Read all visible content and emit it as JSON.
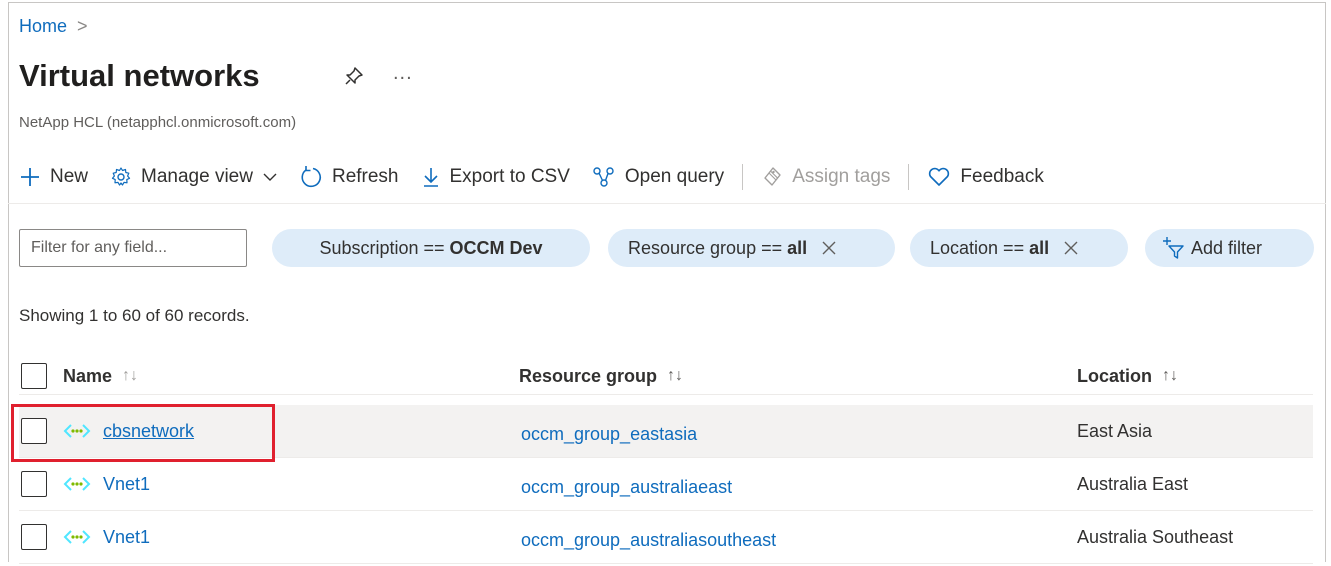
{
  "breadcrumb": {
    "home": "Home",
    "separator": ">"
  },
  "page": {
    "title": "Virtual networks",
    "more": "...",
    "subtitle": "NetApp HCL (netapphcl.onmicrosoft.com)"
  },
  "toolbar": {
    "new": "New",
    "manage_view": "Manage view",
    "refresh": "Refresh",
    "export_csv": "Export to CSV",
    "open_query": "Open query",
    "assign_tags": "Assign tags",
    "feedback": "Feedback"
  },
  "filters": {
    "search_placeholder": "Filter for any field...",
    "subscription": {
      "label": "Subscription ==",
      "value": "OCCM Dev"
    },
    "resource_group": {
      "label": "Resource group ==",
      "value": "all"
    },
    "location": {
      "label": "Location ==",
      "value": "all"
    },
    "add_filter": "Add filter"
  },
  "records_text": "Showing 1 to 60 of 60 records.",
  "table": {
    "columns": {
      "name": "Name",
      "resource_group": "Resource group",
      "location": "Location"
    },
    "sort_glyph": "↑↓",
    "rows": [
      {
        "name": "cbsnetwork",
        "resource_group": "occm_group_eastasia",
        "location": "East Asia"
      },
      {
        "name": "Vnet1",
        "resource_group": "occm_group_australiaeast",
        "location": "Australia East"
      },
      {
        "name": "Vnet1",
        "resource_group": "occm_group_australiasoutheast",
        "location": "Australia Southeast"
      }
    ]
  },
  "colors": {
    "link": "#0f6cbd",
    "pill": "#deecf9",
    "highlight": "#e0202e",
    "selected_row": "#f3f2f1"
  },
  "icons": [
    "pin-icon",
    "plus-icon",
    "gear-icon",
    "chevron-down-icon",
    "refresh-icon",
    "download-icon",
    "query-icon",
    "tag-icon",
    "heart-icon",
    "close-icon",
    "add-filter-icon",
    "virtual-network-icon"
  ]
}
